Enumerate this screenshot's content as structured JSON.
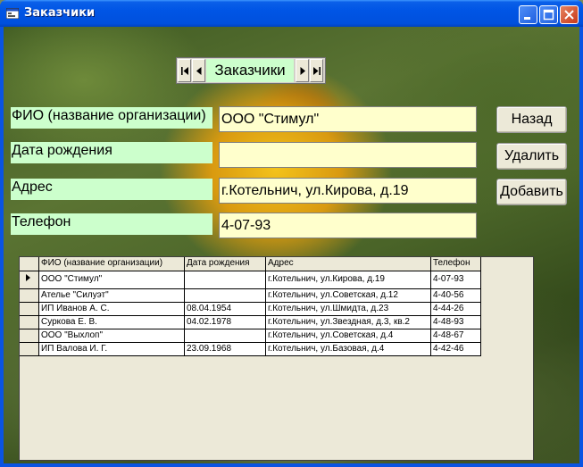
{
  "window": {
    "title": "Заказчики"
  },
  "navigator": {
    "label": "Заказчики"
  },
  "fields": [
    {
      "label": "ФИО (название организации)",
      "value": "ООО \"Стимул\""
    },
    {
      "label": "Дата рождения",
      "value": ""
    },
    {
      "label": "Адрес",
      "value": "г.Котельнич, ул.Кирова, д.19"
    },
    {
      "label": "Телефон",
      "value": "4-07-93"
    }
  ],
  "buttons": {
    "back": "Назад",
    "delete": "Удалить",
    "add": "Добавить"
  },
  "grid": {
    "columns": [
      "ФИО (название организации)",
      "Дата рождения",
      "Адрес",
      "Телефон"
    ],
    "rows": [
      [
        "ООО \"Стимул\"",
        "",
        "г.Котельнич, ул.Кирова, д.19",
        "4-07-93"
      ],
      [
        "Ателье \"Силуэт\"",
        "",
        "г.Котельнич, ул.Советская, д.12",
        "4-40-56"
      ],
      [
        "ИП Иванов А. С.",
        "08.04.1954",
        "г.Котельнич, ул.Шмидта, д.23",
        "4-44-26"
      ],
      [
        "Суркова Е. В.",
        "04.02.1978",
        "г.Котельнич, ул.Звездная, д.3, кв.2",
        "4-48-93"
      ],
      [
        "ООО \"Выхлоп\"",
        "",
        "г.Котельнич, ул.Советская, д.4",
        "4-48-67"
      ],
      [
        "ИП Валова И. Г.",
        "23.09.1968",
        "г.Котельнич, ул.Базовая, д.4",
        "4-42-46"
      ]
    ],
    "selected_row": 0
  },
  "colors": {
    "label_bg": "#ccffcc",
    "input_bg": "#ffffcc",
    "titlebar": "#0055e5"
  },
  "icons": {
    "app": "form-icon",
    "first": "first-record-icon",
    "prev": "prev-record-icon",
    "next": "next-record-icon",
    "last": "last-record-icon",
    "minimize": "minimize-icon",
    "maximize": "maximize-icon",
    "close": "close-icon",
    "row_pointer": "row-pointer-icon"
  }
}
